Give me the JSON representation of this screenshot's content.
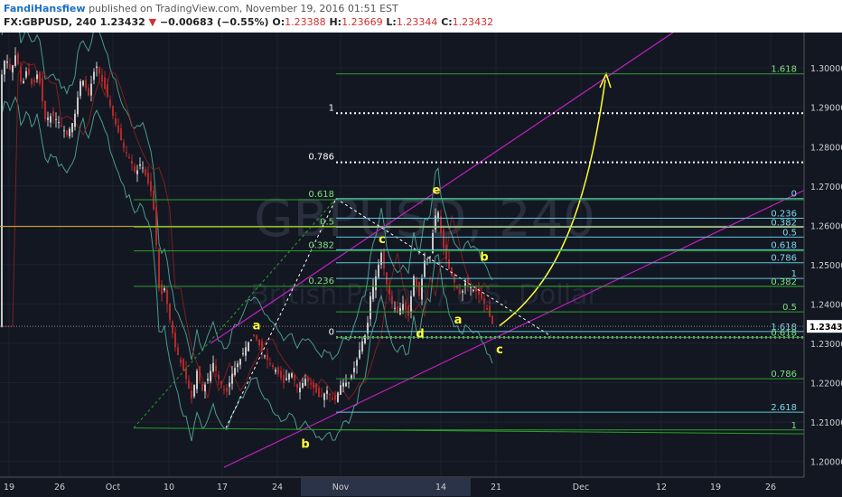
{
  "header": {
    "username": "FandiHansfiew",
    "published_text": "published on TradingView.com, November 19, 2016 01:51 EST",
    "symbol": "FX:GBPUSD, 240",
    "last": "1.23432",
    "change_arrow": "▼",
    "change": "−0.00683 (−0.55%)",
    "o_label": "O:",
    "o": "1.23388",
    "h_label": "H:",
    "h": "1.23669",
    "l_label": "L:",
    "l": "1.23344",
    "c_label": "C:",
    "c": "1.23432"
  },
  "watermark": {
    "line1": "GBPUSD, 240",
    "line2": "British Pound / U.S. Dollar"
  },
  "colors": {
    "background": "#131722",
    "grid": "#1d2230",
    "candle_up": "#c8c8c8",
    "candle_down": "#b02a2a",
    "bollinger": "#4a9a8a",
    "ma": "#7a2020",
    "channel": "#c020c0",
    "fib_green": "#2ca02c",
    "fib_cyan": "#5fc8d8",
    "fib_white": "#ffffff",
    "label_green": "#7fe07f",
    "label_cyan": "#7fd8e8",
    "label_yellow": "#ffff33",
    "price_tag": "#ffffff",
    "orange_line": "#e0b020"
  },
  "chart_data": {
    "type": "candlestick",
    "symbol": "FX:GBPUSD",
    "timeframe": "240",
    "ylim": [
      1.196,
      1.309
    ],
    "y_ticks": [
      "1.30000",
      "1.29000",
      "1.28000",
      "1.27000",
      "1.26000",
      "1.25000",
      "1.24000",
      "1.23000",
      "1.22000",
      "1.21000",
      "1.20000"
    ],
    "x_ticks": [
      "19",
      "26",
      "Oct",
      "10",
      "17",
      "24",
      "Nov",
      "14",
      "21",
      "Dec",
      "12",
      "19",
      "26"
    ],
    "last_price": "1.23432",
    "close_path": [
      [
        0,
        1.296
      ],
      [
        6,
        1.303
      ],
      [
        12,
        1.299
      ],
      [
        18,
        1.304
      ],
      [
        24,
        1.295
      ],
      [
        30,
        1.3
      ],
      [
        36,
        1.295
      ],
      [
        42,
        1.299
      ],
      [
        50,
        1.287
      ],
      [
        58,
        1.288
      ],
      [
        66,
        1.286
      ],
      [
        74,
        1.283
      ],
      [
        82,
        1.287
      ],
      [
        90,
        1.298
      ],
      [
        98,
        1.293
      ],
      [
        106,
        1.301
      ],
      [
        114,
        1.296
      ],
      [
        120,
        1.292
      ],
      [
        126,
        1.287
      ],
      [
        132,
        1.283
      ],
      [
        138,
        1.279
      ],
      [
        144,
        1.277
      ],
      [
        150,
        1.273
      ],
      [
        156,
        1.276
      ],
      [
        162,
        1.272
      ],
      [
        168,
        1.268
      ],
      [
        172,
        1.26
      ],
      [
        175,
        1.245
      ],
      [
        178,
        1.242
      ],
      [
        182,
        1.244
      ],
      [
        188,
        1.236
      ],
      [
        194,
        1.229
      ],
      [
        200,
        1.225
      ],
      [
        206,
        1.221
      ],
      [
        212,
        1.216
      ],
      [
        218,
        1.223
      ],
      [
        224,
        1.218
      ],
      [
        230,
        1.221
      ],
      [
        236,
        1.225
      ],
      [
        242,
        1.221
      ],
      [
        250,
        1.217
      ],
      [
        258,
        1.223
      ],
      [
        266,
        1.226
      ],
      [
        274,
        1.23
      ],
      [
        282,
        1.232
      ],
      [
        290,
        1.228
      ],
      [
        298,
        1.225
      ],
      [
        306,
        1.223
      ],
      [
        314,
        1.22
      ],
      [
        322,
        1.223
      ],
      [
        330,
        1.218
      ],
      [
        338,
        1.221
      ],
      [
        346,
        1.219
      ],
      [
        354,
        1.216
      ],
      [
        362,
        1.218
      ],
      [
        370,
        1.215
      ],
      [
        378,
        1.22
      ],
      [
        386,
        1.22
      ],
      [
        394,
        1.225
      ],
      [
        400,
        1.23
      ],
      [
        406,
        1.233
      ],
      [
        410,
        1.242
      ],
      [
        416,
        1.247
      ],
      [
        422,
        1.253
      ],
      [
        428,
        1.245
      ],
      [
        434,
        1.24
      ],
      [
        440,
        1.238
      ],
      [
        446,
        1.24
      ],
      [
        452,
        1.237
      ],
      [
        458,
        1.247
      ],
      [
        464,
        1.242
      ],
      [
        470,
        1.251
      ],
      [
        476,
        1.252
      ],
      [
        480,
        1.26
      ],
      [
        484,
        1.265
      ],
      [
        488,
        1.258
      ],
      [
        492,
        1.253
      ],
      [
        498,
        1.248
      ],
      [
        504,
        1.245
      ],
      [
        510,
        1.242
      ],
      [
        516,
        1.246
      ],
      [
        522,
        1.244
      ],
      [
        528,
        1.243
      ],
      [
        534,
        1.241
      ],
      [
        540,
        1.238
      ],
      [
        546,
        1.2343
      ]
    ],
    "fib_levels": [
      {
        "label": "1.618",
        "price": 1.2985,
        "color": "green",
        "side": "right"
      },
      {
        "label": "1",
        "price": 1.2885,
        "color": "white",
        "side": "left"
      },
      {
        "label": "0.786",
        "price": 1.276,
        "color": "white",
        "side": "left"
      },
      {
        "label": "0.618",
        "price": 1.2665,
        "color": "green",
        "side": "left"
      },
      {
        "label": "0.5",
        "price": 1.2595,
        "color": "green",
        "side": "left"
      },
      {
        "label": "0.382",
        "price": 1.2535,
        "color": "green",
        "side": "left"
      },
      {
        "label": "0.236",
        "price": 1.2445,
        "color": "green",
        "side": "left"
      },
      {
        "label": "0",
        "price": 1.2315,
        "color": "white",
        "side": "left"
      },
      {
        "label": "0",
        "price": 1.2668,
        "color": "cyan",
        "side": "right"
      },
      {
        "label": "0.236",
        "price": 1.2618,
        "color": "cyan",
        "side": "right"
      },
      {
        "label": "0.382",
        "price": 1.2595,
        "color": "cyan",
        "side": "right"
      },
      {
        "label": "0.5",
        "price": 1.257,
        "color": "cyan",
        "side": "right"
      },
      {
        "label": "0.618",
        "price": 1.2538,
        "color": "cyan",
        "side": "right"
      },
      {
        "label": "0.786",
        "price": 1.2505,
        "color": "cyan",
        "side": "right"
      },
      {
        "label": "1",
        "price": 1.2465,
        "color": "cyan",
        "side": "right"
      },
      {
        "label": "0.382",
        "price": 1.2445,
        "color": "green",
        "side": "right"
      },
      {
        "label": "0.5",
        "price": 1.238,
        "color": "green",
        "side": "right"
      },
      {
        "label": "1.618",
        "price": 1.233,
        "color": "cyan",
        "side": "right"
      },
      {
        "label": "0.618",
        "price": 1.2315,
        "color": "green",
        "side": "right"
      },
      {
        "label": "0.786",
        "price": 1.221,
        "color": "green",
        "side": "right"
      },
      {
        "label": "2.618",
        "price": 1.2125,
        "color": "cyan",
        "side": "right"
      },
      {
        "label": "1",
        "price": 1.208,
        "color": "green",
        "side": "right"
      }
    ],
    "wave_labels": [
      {
        "text": "e",
        "x": 483,
        "price": 1.268
      },
      {
        "text": "c",
        "x": 423,
        "price": 1.2555
      },
      {
        "text": "b",
        "x": 536,
        "price": 1.251
      },
      {
        "text": "a",
        "x": 284,
        "price": 1.2335
      },
      {
        "text": "a",
        "x": 507,
        "price": 1.235
      },
      {
        "text": "d",
        "x": 465,
        "price": 1.2315
      },
      {
        "text": "c",
        "x": 553,
        "price": 1.2275
      },
      {
        "text": "b",
        "x": 338,
        "price": 1.2035
      }
    ]
  }
}
